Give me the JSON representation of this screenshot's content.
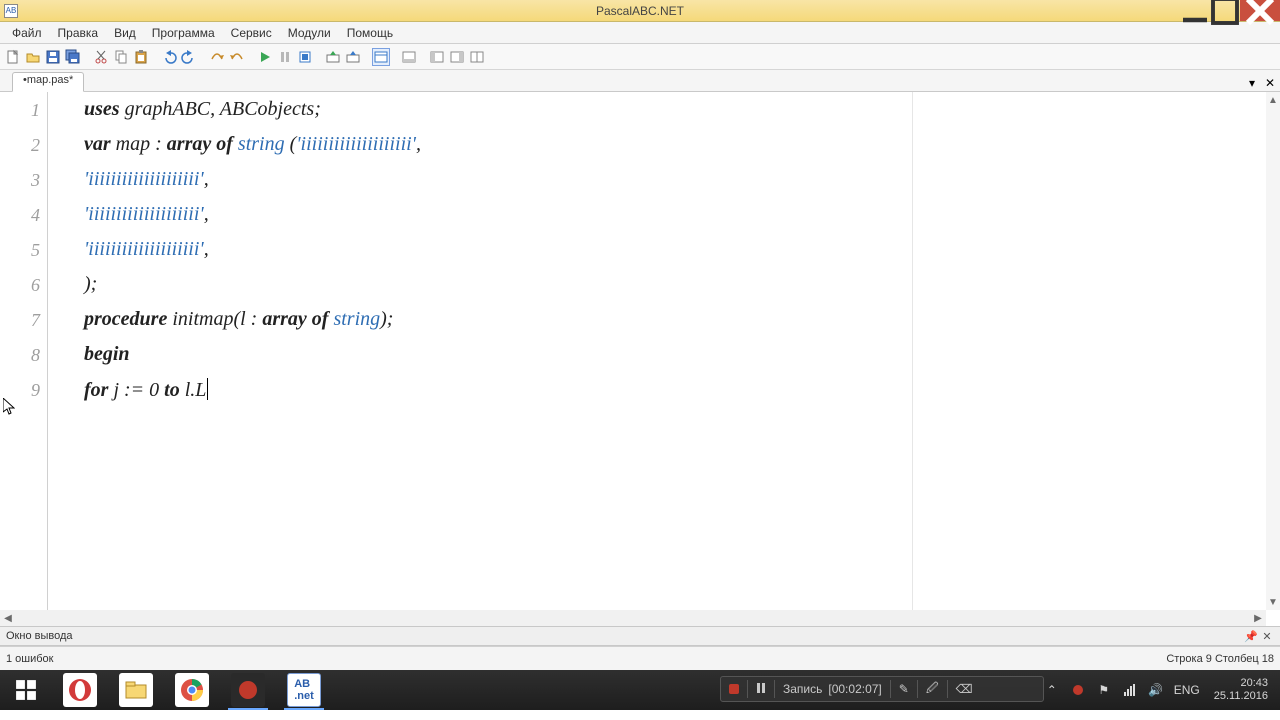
{
  "window": {
    "title": "PascalABC.NET",
    "app_icon_label": "AB"
  },
  "menus": [
    "Файл",
    "Правка",
    "Вид",
    "Программа",
    "Сервис",
    "Модули",
    "Помощь"
  ],
  "tabs": {
    "active": "•map.pas*"
  },
  "code": {
    "lines": [
      {
        "n": "1",
        "segs": [
          {
            "t": "uses",
            "c": "kw"
          },
          {
            "t": " graphABC, ABCobjects;",
            "c": ""
          }
        ]
      },
      {
        "n": "2",
        "segs": [
          {
            "t": "var",
            "c": "kw"
          },
          {
            "t": " map : ",
            "c": ""
          },
          {
            "t": "array",
            "c": "kw"
          },
          {
            "t": " ",
            "c": ""
          },
          {
            "t": "of",
            "c": "kw"
          },
          {
            "t": " ",
            "c": ""
          },
          {
            "t": "string",
            "c": "type"
          },
          {
            "t": " (",
            "c": ""
          },
          {
            "t": "'iiiiiiiiiiiiiiiiiiii'",
            "c": "str"
          },
          {
            "t": ",",
            "c": ""
          }
        ]
      },
      {
        "n": "3",
        "segs": [
          {
            "t": "'iiiiiiiiiiiiiiiiiiii'",
            "c": "str"
          },
          {
            "t": ",",
            "c": ""
          }
        ]
      },
      {
        "n": "4",
        "segs": [
          {
            "t": "'iiiiiiiiiiiiiiiiiiii'",
            "c": "str"
          },
          {
            "t": ",",
            "c": ""
          }
        ]
      },
      {
        "n": "5",
        "segs": [
          {
            "t": "'iiiiiiiiiiiiiiiiiiii'",
            "c": "str"
          },
          {
            "t": ",",
            "c": ""
          }
        ]
      },
      {
        "n": "6",
        "segs": [
          {
            "t": ");",
            "c": ""
          }
        ]
      },
      {
        "n": "7",
        "segs": [
          {
            "t": "procedure",
            "c": "kw"
          },
          {
            "t": " initmap(l : ",
            "c": ""
          },
          {
            "t": "array",
            "c": "kw"
          },
          {
            "t": " ",
            "c": ""
          },
          {
            "t": "of",
            "c": "kw"
          },
          {
            "t": " ",
            "c": ""
          },
          {
            "t": "string",
            "c": "type"
          },
          {
            "t": ");",
            "c": ""
          }
        ]
      },
      {
        "n": "8",
        "segs": [
          {
            "t": "begin",
            "c": "kw"
          }
        ]
      },
      {
        "n": "9",
        "segs": [
          {
            "t": "for",
            "c": "kw"
          },
          {
            "t": " j := 0 ",
            "c": ""
          },
          {
            "t": "to",
            "c": "kw"
          },
          {
            "t": " l.L",
            "c": ""
          }
        ],
        "caret": true
      }
    ]
  },
  "output_panel": {
    "title": "Окно вывода"
  },
  "status": {
    "errors": "1 ошибок",
    "pos": "Строка  9  Столбец  18"
  },
  "toolbar_icons": [
    "new-file",
    "open-file",
    "save-file",
    "save-all",
    "print",
    "cut",
    "copy",
    "paste",
    "undo",
    "redo",
    "find",
    "step-back",
    "run",
    "pause",
    "stop",
    "compile",
    "toggle-1",
    "toggle-2",
    "view-1",
    "view-2",
    "view-3",
    "view-4",
    "view-5"
  ],
  "recorder": {
    "label": "Запись",
    "time": "[00:02:07]"
  },
  "tray": {
    "lang": "ENG",
    "time": "20:43",
    "date": "25.11.2016"
  }
}
